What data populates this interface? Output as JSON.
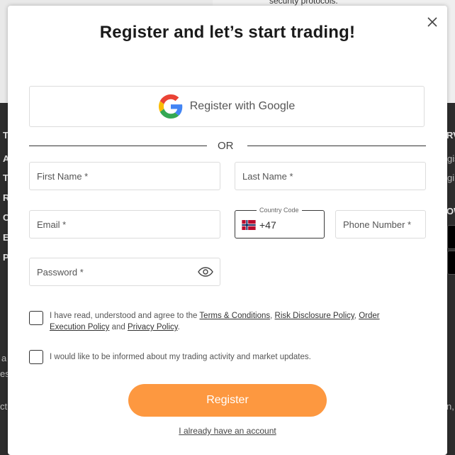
{
  "background": {
    "top_text": "security protocols.",
    "dark_fragments_left": [
      "T",
      "A",
      "T",
      "R",
      "C",
      "E",
      "P",
      "a",
      "es",
      "ct"
    ],
    "dark_fragments_right": [
      "RV",
      "gis",
      "gi",
      "OW",
      "n,"
    ]
  },
  "modal": {
    "title": "Register and let’s start trading!",
    "close_icon": "close-icon",
    "google": {
      "label": "Register with Google",
      "icon": "google-icon"
    },
    "divider_text": "OR",
    "fields": {
      "first_name": {
        "placeholder": "First Name *",
        "value": ""
      },
      "last_name": {
        "placeholder": "Last Name *",
        "value": ""
      },
      "email": {
        "placeholder": "Email *",
        "value": ""
      },
      "country_code": {
        "label": "Country Code",
        "value": "+47",
        "flag": "norway-flag"
      },
      "phone": {
        "placeholder": "Phone Number *",
        "value": ""
      },
      "password": {
        "placeholder": "Password *",
        "value": "",
        "icon": "eye-icon"
      }
    },
    "terms": {
      "prefix": "I have read, understood and agree to the ",
      "terms_link": "Terms & Conditions",
      "sep1": ", ",
      "risk_link": "Risk Disclosure Policy",
      "sep2": ", ",
      "order_link": "Order Execution Policy",
      "and": " and ",
      "privacy_link": "Privacy Policy",
      "suffix": "."
    },
    "updates_label": "I would like to be informed about my trading activity and market updates.",
    "register_button": "Register",
    "have_account_link": "I already have an account"
  },
  "colors": {
    "accent": "#fd9840",
    "overlay_dark": "#2d2d2d"
  }
}
